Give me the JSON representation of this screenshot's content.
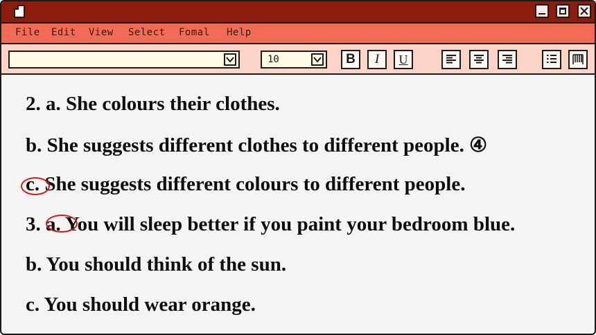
{
  "window": {
    "title_icon": "document-icon",
    "controls": [
      "minimize-icon",
      "maximize-icon",
      "close-icon"
    ]
  },
  "menu": {
    "items": [
      "File",
      "Edit",
      "View",
      "Select",
      "Fomal",
      "Help"
    ]
  },
  "toolbar": {
    "font_value": "",
    "size_value": "10",
    "bold_label": "B",
    "italic_label": "I",
    "underline_label": "U"
  },
  "content": {
    "lines": [
      "2. a. She colours their clothes.",
      "b. She suggests different clothes to different people. ④",
      "c. She suggests different colours to different people.",
      "3. a. You will sleep better if you paint your bedroom blue.",
      "b. You should think of the sun.",
      "c. You should wear orange."
    ],
    "annotation_color": "#d11a1a"
  },
  "colors": {
    "titlebar": "#8b1d0e",
    "menubar": "#f26b55",
    "toolbar": "#fbd3c7",
    "content_bg": "#f6f4f2"
  }
}
